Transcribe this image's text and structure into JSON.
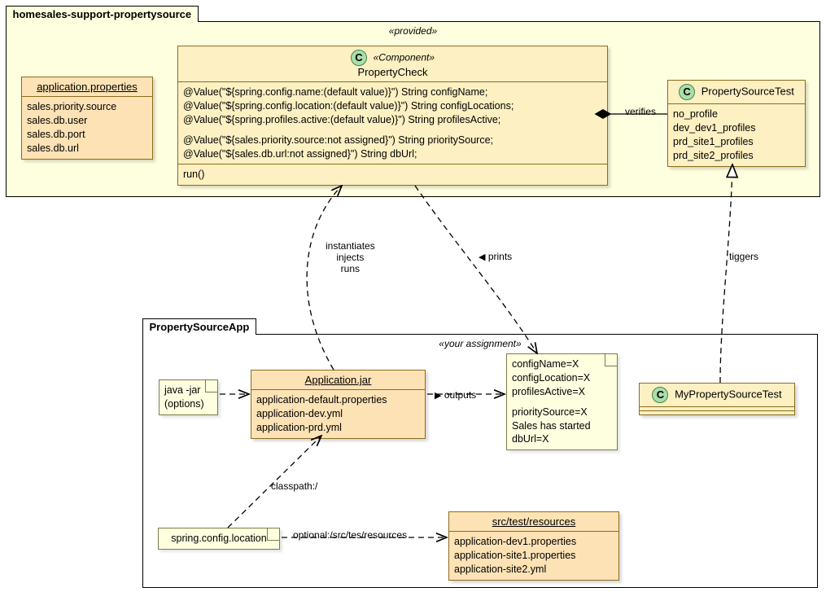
{
  "pkg1": {
    "name": "homesales-support-propertysource",
    "stereo": "«provided»",
    "propfile": {
      "title": "application.properties",
      "p1": "sales.priority.source",
      "p2": "sales.db.user",
      "p3": "sales.db.port",
      "p4": "sales.db.url"
    },
    "propertyCheck": {
      "stereo": "«Component»",
      "name": "PropertyCheck",
      "a1": "@Value(\"${spring.config.name:(default value)}\") String configName;",
      "a2": "@Value(\"${spring.config.location:(default value)}\") String configLocations;",
      "a3": "@Value(\"${spring.profiles.active:(default value)}\") String profilesActive;",
      "a4": "@Value(\"${sales.priority.source:not assigned}\") String prioritySource;",
      "a5": "@Value(\"${sales.db.url:not assigned}\") String dbUrl;",
      "m1": "run()"
    },
    "propSourceTest": {
      "name": "PropertySourceTest",
      "r1": "no_profile",
      "r2": "dev_dev1_profiles",
      "r3": "prd_site1_profiles",
      "r4": "prd_site2_profiles"
    }
  },
  "pkg2": {
    "name": "PropertySourceApp",
    "stereo": "«your assignment»",
    "javaJar": {
      "l1": "java -jar",
      "l2": "(options)"
    },
    "appJar": {
      "title": "Application.jar",
      "f1": "application-default.properties",
      "f2": "application-dev.yml",
      "f3": "application-prd.yml"
    },
    "output": {
      "l1": "configName=X",
      "l2": "configLocation=X",
      "l3": "profilesActive=X",
      "l4": "prioritySource=X",
      "l5": "Sales has started",
      "l6": "dbUrl=X"
    },
    "myTest": {
      "name": "MyPropertySourceTest"
    },
    "scl": {
      "name": "spring.config.location"
    },
    "testRes": {
      "title": "src/test/resources",
      "f1": "application-dev1.properties",
      "f2": "application-site1.properties",
      "f3": "application-site2.yml"
    }
  },
  "labels": {
    "verifies": "verifies",
    "instantiates": "instantiates\ninjects\nruns",
    "prints": "prints",
    "tiggers": "tiggers",
    "outputs": "outputs",
    "classpath": "classpath:/",
    "optional": "optional:/src/tes/resources"
  }
}
